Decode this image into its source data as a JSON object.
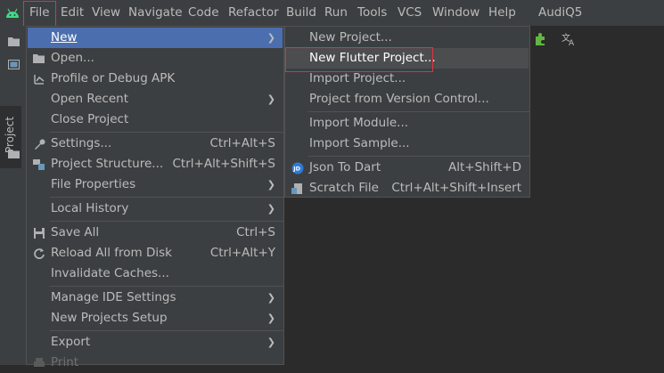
{
  "menubar": {
    "items": [
      "File",
      "Edit",
      "View",
      "Navigate",
      "Code",
      "Refactor",
      "Build",
      "Run",
      "Tools",
      "VCS",
      "Window",
      "Help"
    ],
    "project_title": "AudiQ5"
  },
  "tool_window": {
    "project_label": "Project"
  },
  "file_menu": {
    "new": "New",
    "open": "Open...",
    "profile_debug_apk": "Profile or Debug APK",
    "open_recent": "Open Recent",
    "close_project": "Close Project",
    "settings": "Settings...",
    "settings_shortcut": "Ctrl+Alt+S",
    "project_structure": "Project Structure...",
    "project_structure_shortcut": "Ctrl+Alt+Shift+S",
    "file_properties": "File Properties",
    "local_history": "Local History",
    "save_all": "Save All",
    "save_all_shortcut": "Ctrl+S",
    "reload_all": "Reload All from Disk",
    "reload_all_shortcut": "Ctrl+Alt+Y",
    "invalidate_caches": "Invalidate Caches...",
    "manage_ide_settings": "Manage IDE Settings",
    "new_projects_setup": "New Projects Setup",
    "export": "Export",
    "print": "Print"
  },
  "new_submenu": {
    "new_project": "New Project...",
    "new_flutter_project": "New Flutter Project...",
    "import_project": "Import Project...",
    "project_from_vcs": "Project from Version Control...",
    "import_module": "Import Module...",
    "import_sample": "Import Sample...",
    "json_to_dart": "Json To Dart",
    "json_to_dart_shortcut": "Alt+Shift+D",
    "scratch_file": "Scratch File",
    "scratch_file_shortcut": "Ctrl+Alt+Shift+Insert"
  },
  "colors": {
    "background": "#2b2b2b",
    "menu_bg": "#3c3f41",
    "highlight": "#4b6eaf",
    "hover": "#4b4d4f",
    "annotation_red": "#d9363e"
  }
}
